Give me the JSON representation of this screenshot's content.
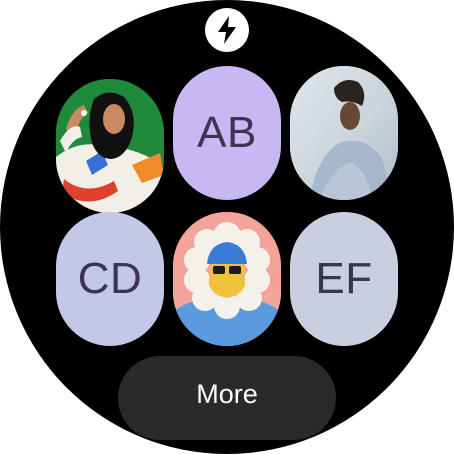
{
  "colors": {
    "background": "#000000",
    "purple_tile": "#c7b7f2",
    "blue_tile": "#c2c8e6",
    "grey_tile": "#c9cfe0",
    "tile_text": "#3b3552",
    "more_button": "#2a2a2a",
    "more_text": "#ffffff"
  },
  "top_icon": {
    "name": "lightning-bolt-icon"
  },
  "contacts": [
    {
      "kind": "avatar",
      "description_icon": "avatar-woman-hijab"
    },
    {
      "kind": "initials",
      "initials": "AB"
    },
    {
      "kind": "avatar",
      "description_icon": "avatar-photo-portrait"
    },
    {
      "kind": "initials",
      "initials": "CD"
    },
    {
      "kind": "avatar",
      "description_icon": "avatar-winter-hood"
    },
    {
      "kind": "initials",
      "initials": "EF"
    }
  ],
  "more_button": {
    "label": "More"
  }
}
